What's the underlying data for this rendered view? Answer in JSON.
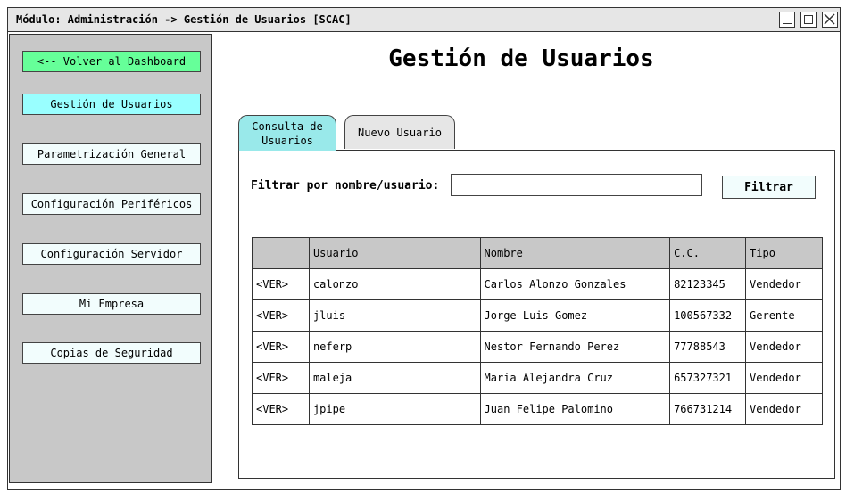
{
  "window": {
    "title": "Módulo: Administración -> Gestión de Usuarios [SCAC]"
  },
  "sidebar": {
    "back_label": "<-- Volver al Dashboard",
    "items": [
      {
        "label": "Gestión de Usuarios",
        "active": true
      },
      {
        "label": "Parametrización General"
      },
      {
        "label": "Configuración Periféricos"
      },
      {
        "label": "Configuración Servidor"
      },
      {
        "label": "Mi Empresa"
      },
      {
        "label": "Copias de Seguridad"
      }
    ]
  },
  "main": {
    "title": "Gestión de Usuarios",
    "tabs": [
      {
        "label": "Consulta de Usuarios",
        "active": true
      },
      {
        "label": "Nuevo Usuario"
      }
    ],
    "filter": {
      "label": "Filtrar por nombre/usuario:",
      "value": "",
      "placeholder": "",
      "button_label": "Filtrar"
    },
    "table": {
      "headers": [
        "",
        "Usuario",
        "Nombre",
        "C.C.",
        "Tipo"
      ],
      "rows": [
        [
          "<VER>",
          "calonzo",
          "Carlos Alonzo Gonzales",
          "82123345",
          "Vendedor"
        ],
        [
          "<VER>",
          "jluis",
          "Jorge Luis Gomez",
          "100567332",
          "Gerente"
        ],
        [
          "<VER>",
          "neferp",
          "Nestor Fernando Perez",
          "77788543",
          "Vendedor"
        ],
        [
          "<VER>",
          "maleja",
          "Maria Alejandra Cruz",
          "657327321",
          "Vendedor"
        ],
        [
          "<VER>",
          "jpipe",
          "Juan Felipe Palomino",
          "766731214",
          "Vendedor"
        ]
      ]
    }
  },
  "colors": {
    "back_button": "#66ff99",
    "active_item": "#99ffff",
    "active_tab": "#99e9ea",
    "sidebar_bg": "#c8c8c8",
    "header_bg": "#c8c8c8"
  }
}
